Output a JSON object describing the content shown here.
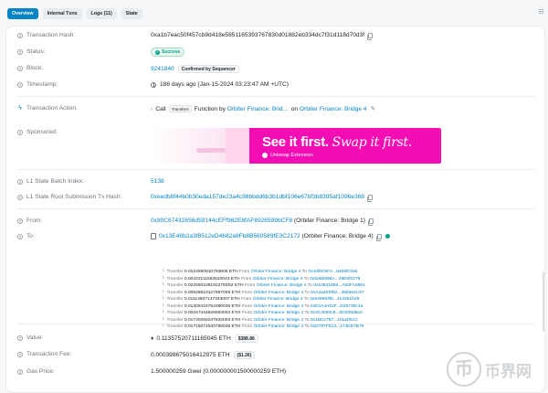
{
  "tabs": [
    "Overview",
    "Internal Txns",
    "Logs (11)",
    "State"
  ],
  "menu_icon": "grid-menu-icon",
  "fields": {
    "tx_hash": {
      "label": "Transaction Hash:",
      "value": "0xa1b7eac50f457cb9d418e5851165393767830d01882eb334dc7f31d118d70d3f"
    },
    "status": {
      "label": "Status:",
      "value": "Success"
    },
    "block": {
      "label": "Block:",
      "value": "9241840",
      "badge": "Confirmed by Sequencer"
    },
    "timestamp": {
      "label": "Timestamp:",
      "value": "186 days ago (Jan-15-2024 03:23:47 AM +UTC)"
    },
    "action": {
      "label": "Transaction Action:",
      "call": "Call",
      "method": "Transfers",
      "function_text": "Function by",
      "by": "Orbiter Finance: Brid...",
      "on_text": "on",
      "on": "Orbiter Finance: Bridge 4"
    },
    "sponsored": {
      "label": "Sponsored:",
      "ad_headline": "See it first.",
      "ad_headline_italic": "Swap it first.",
      "ad_sub": "Uniswap Extension"
    },
    "batch": {
      "label": "L1 State Batch Index:",
      "value": "5138"
    },
    "root": {
      "label": "L1 State Root Submission Tx Hash:",
      "value": "0xeedb8f44b0b30eda157de23a4c98bbdd6b3b1dbf106e67bf3b8395af1096e368"
    },
    "from": {
      "label": "From:",
      "value": "0x80C67432656d59144cEFf962E8fAF8926599bCF8",
      "name": "(Orbiter Finance: Bridge 1)"
    },
    "to": {
      "label": "To:",
      "value": "0x13E46b2a3f8512eD4682a8Fb8B560589fE3C2172",
      "name": "(Orbiter Finance: Bridge 4)"
    },
    "value": {
      "label": "Value:",
      "value": "0.11357520711165045 ETH",
      "usd": "$388.86"
    },
    "fee": {
      "label": "Transaction Fee:",
      "value": "0.000398675016412975 ETH",
      "usd": "($1.26)"
    },
    "gas": {
      "label": "Gas Price:",
      "value": "1.500000259 Gwei (0.000000001500000259 ETH)"
    }
  },
  "transfers": [
    {
      "amount": "0.0124590910793606 ETH",
      "from": "Orbiter Finance: Bridge 4",
      "to": "0x4ef8C6FA...6405f03a6"
    },
    {
      "amount": "0.00423111563520043 ETH",
      "from": "Orbiter Finance: Bridge 4",
      "to": "0x5a5b858A...49E5f0276"
    },
    {
      "amount": "0.0225501081922750S2 ETH",
      "from": "Orbiter Finance: Bridge 4",
      "to": "0x10641859...A0dFA5881"
    },
    {
      "amount": "0.00526619127867005 ETH",
      "from": "Orbiter Finance: Bridge 4",
      "to": "0xA2a2E5f82...35b664C67"
    },
    {
      "amount": "0.01114507147343007 ETH",
      "from": "Orbiter Finance: Bridge 4",
      "to": "0x649693f6...413351b29"
    },
    {
      "amount": "0.01305416764390036 ETH",
      "from": "Orbiter Finance: Bridge 4",
      "to": "0xE3A4A61F...D26735c4a"
    },
    {
      "amount": "0.00347444626593004 ETH",
      "from": "Orbiter Finance: Bridge 4",
      "to": "0x3C4080c8...5D208d8a3"
    },
    {
      "amount": "0.01730259237832003 ETH",
      "from": "Orbiter Finance: Bridge 4",
      "to": "0x1BDc787...1f4a4f51C"
    },
    {
      "amount": "0.01716074040780036 ETH",
      "from": "Orbiter Finance: Bridge 4",
      "to": "0xD787F513...174DE7B79"
    }
  ],
  "transfer_word": "Transfer",
  "from_word": "From",
  "to_word": "To",
  "watermark": {
    "coin": "币",
    "text": "币界网"
  },
  "colors": {
    "accent": "#0784c3",
    "success": "#00a186",
    "ad_pink": "#f50db4"
  }
}
